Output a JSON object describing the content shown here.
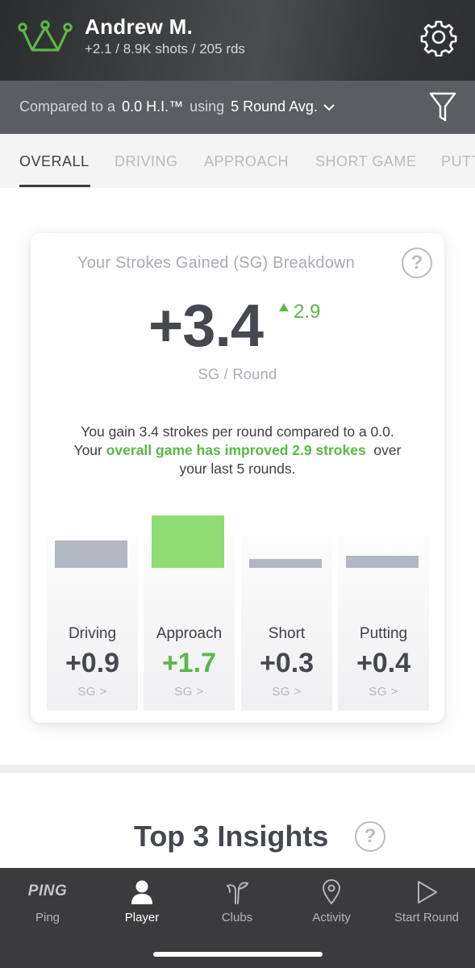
{
  "header": {
    "user_name": "Andrew M.",
    "stats": "+2.1 / 8.9K shots / 205 rds",
    "icons": {
      "logo": "crown-icon",
      "settings": "gear-icon"
    }
  },
  "compare": {
    "prefix": "Compared to a",
    "handicap": "0.0 H.I.™",
    "middle": "using",
    "average": "5 Round Avg.",
    "filter_icon": "filter-icon"
  },
  "tabs": [
    "OVERALL",
    "DRIVING",
    "APPROACH",
    "SHORT GAME",
    "PUTT"
  ],
  "active_tab": "OVERALL",
  "breakdown": {
    "title": "Your Strokes Gained (SG) Breakdown",
    "help": "?",
    "value": "+3.4",
    "delta": "2.9",
    "unit": "SG / Round",
    "desc_line1": "You gain 3.4 strokes per round compared to a 0.0.",
    "desc_line2_pre": "Your ",
    "desc_line2_green": "overall game has improved 2.9 strokes",
    "desc_line2_post": "  over",
    "desc_line3": "your last 5 rounds."
  },
  "chart_data": {
    "type": "bar",
    "categories": [
      "Driving",
      "Approach",
      "Short",
      "Putting"
    ],
    "values": [
      0.9,
      1.7,
      0.3,
      0.4
    ],
    "value_labels": [
      "+0.9",
      "+1.7",
      "+0.3",
      "+0.4"
    ],
    "link_label": "SG >",
    "colors": {
      "default": "#b1b8c1",
      "highlight": "#8fdd74"
    },
    "highlight_index": 1
  },
  "insights": {
    "title": "Top 3 Insights",
    "help": "?"
  },
  "bottom_nav": [
    {
      "label": "Ping",
      "icon": "ping-logo",
      "text": "PING"
    },
    {
      "label": "Player",
      "icon": "player-icon"
    },
    {
      "label": "Clubs",
      "icon": "clubs-icon"
    },
    {
      "label": "Activity",
      "icon": "location-pin-icon"
    },
    {
      "label": "Start Round",
      "icon": "play-icon"
    }
  ],
  "active_nav": "Player",
  "colors": {
    "accent_green": "#5ab848",
    "header_dark": "#3a3b3d",
    "compare_bar": "#5b5d63"
  }
}
